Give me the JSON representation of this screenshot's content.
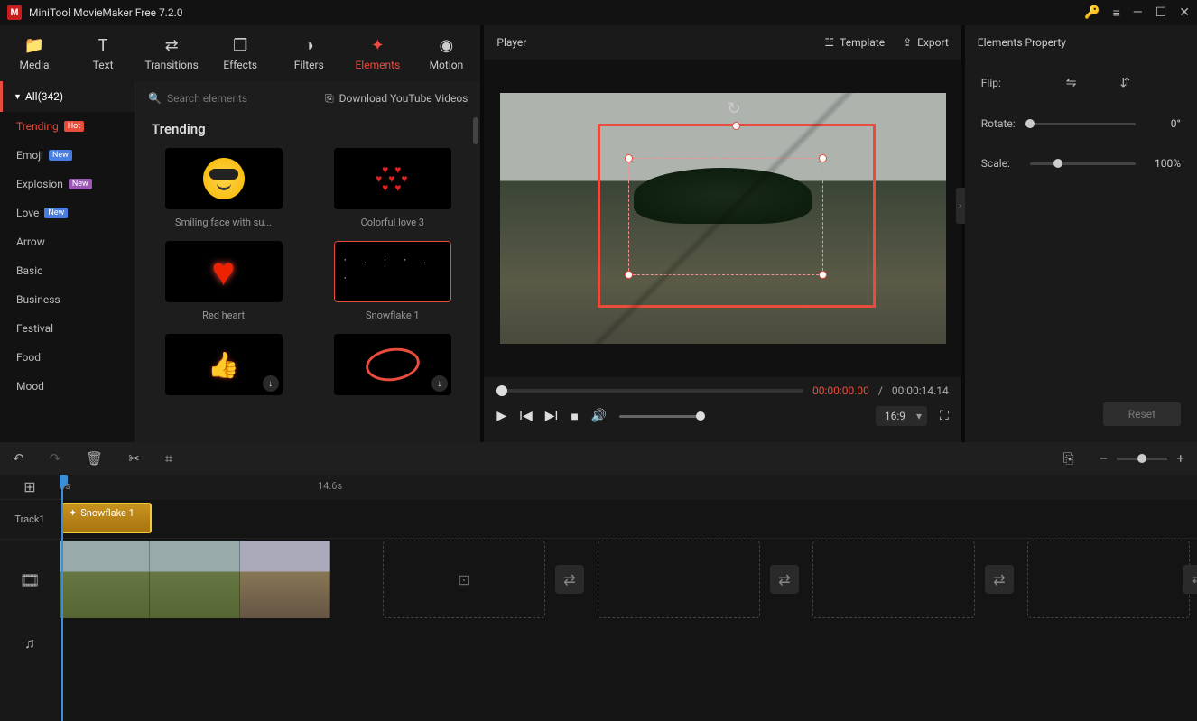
{
  "app": {
    "title": "MiniTool MovieMaker Free 7.2.0"
  },
  "tabs": {
    "media": "Media",
    "text": "Text",
    "transitions": "Transitions",
    "effects": "Effects",
    "filters": "Filters",
    "elements": "Elements",
    "motion": "Motion"
  },
  "sidebar": {
    "all_label": "All(342)",
    "items": [
      {
        "label": "Trending",
        "badge": "Hot",
        "badge_class": "badge-hot",
        "active": true
      },
      {
        "label": "Emoji",
        "badge": "New",
        "badge_class": "badge-new"
      },
      {
        "label": "Explosion",
        "badge": "New",
        "badge_class": "badge-new2"
      },
      {
        "label": "Love",
        "badge": "New",
        "badge_class": "badge-new"
      },
      {
        "label": "Arrow"
      },
      {
        "label": "Basic"
      },
      {
        "label": "Business"
      },
      {
        "label": "Festival"
      },
      {
        "label": "Food"
      },
      {
        "label": "Mood"
      }
    ]
  },
  "search": {
    "placeholder": "Search elements"
  },
  "download_link": "Download YouTube Videos",
  "section_title": "Trending",
  "elements": [
    {
      "label": "Smiling face with su..."
    },
    {
      "label": "Colorful love 3"
    },
    {
      "label": "Red heart"
    },
    {
      "label": "Snowflake 1",
      "selected": true
    },
    {
      "label": "",
      "downloadable": true
    },
    {
      "label": "",
      "downloadable": true
    }
  ],
  "player": {
    "title": "Player",
    "template": "Template",
    "export": "Export",
    "current": "00:00:00.00",
    "sep": " / ",
    "total": "00:00:14.14",
    "aspect": "16:9"
  },
  "props": {
    "title": "Elements Property",
    "flip_label": "Flip:",
    "rotate_label": "Rotate:",
    "rotate_value": "0°",
    "scale_label": "Scale:",
    "scale_value": "100%",
    "scale_pct": 27,
    "reset": "Reset"
  },
  "timeline": {
    "ruler": {
      "t0": "0s",
      "t1": "14.6s"
    },
    "track1_label": "Track1",
    "clip_label": "Snowflake 1"
  }
}
